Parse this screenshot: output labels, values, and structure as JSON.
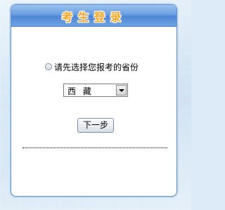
{
  "login": {
    "title": "考生登录",
    "province_label": "请先选择您报考的省份",
    "province_select": {
      "selected": "西 藏"
    },
    "next_button": "下一步"
  },
  "icons": {
    "radio": "radio-icon",
    "dropdown": "chevron-down-icon"
  }
}
